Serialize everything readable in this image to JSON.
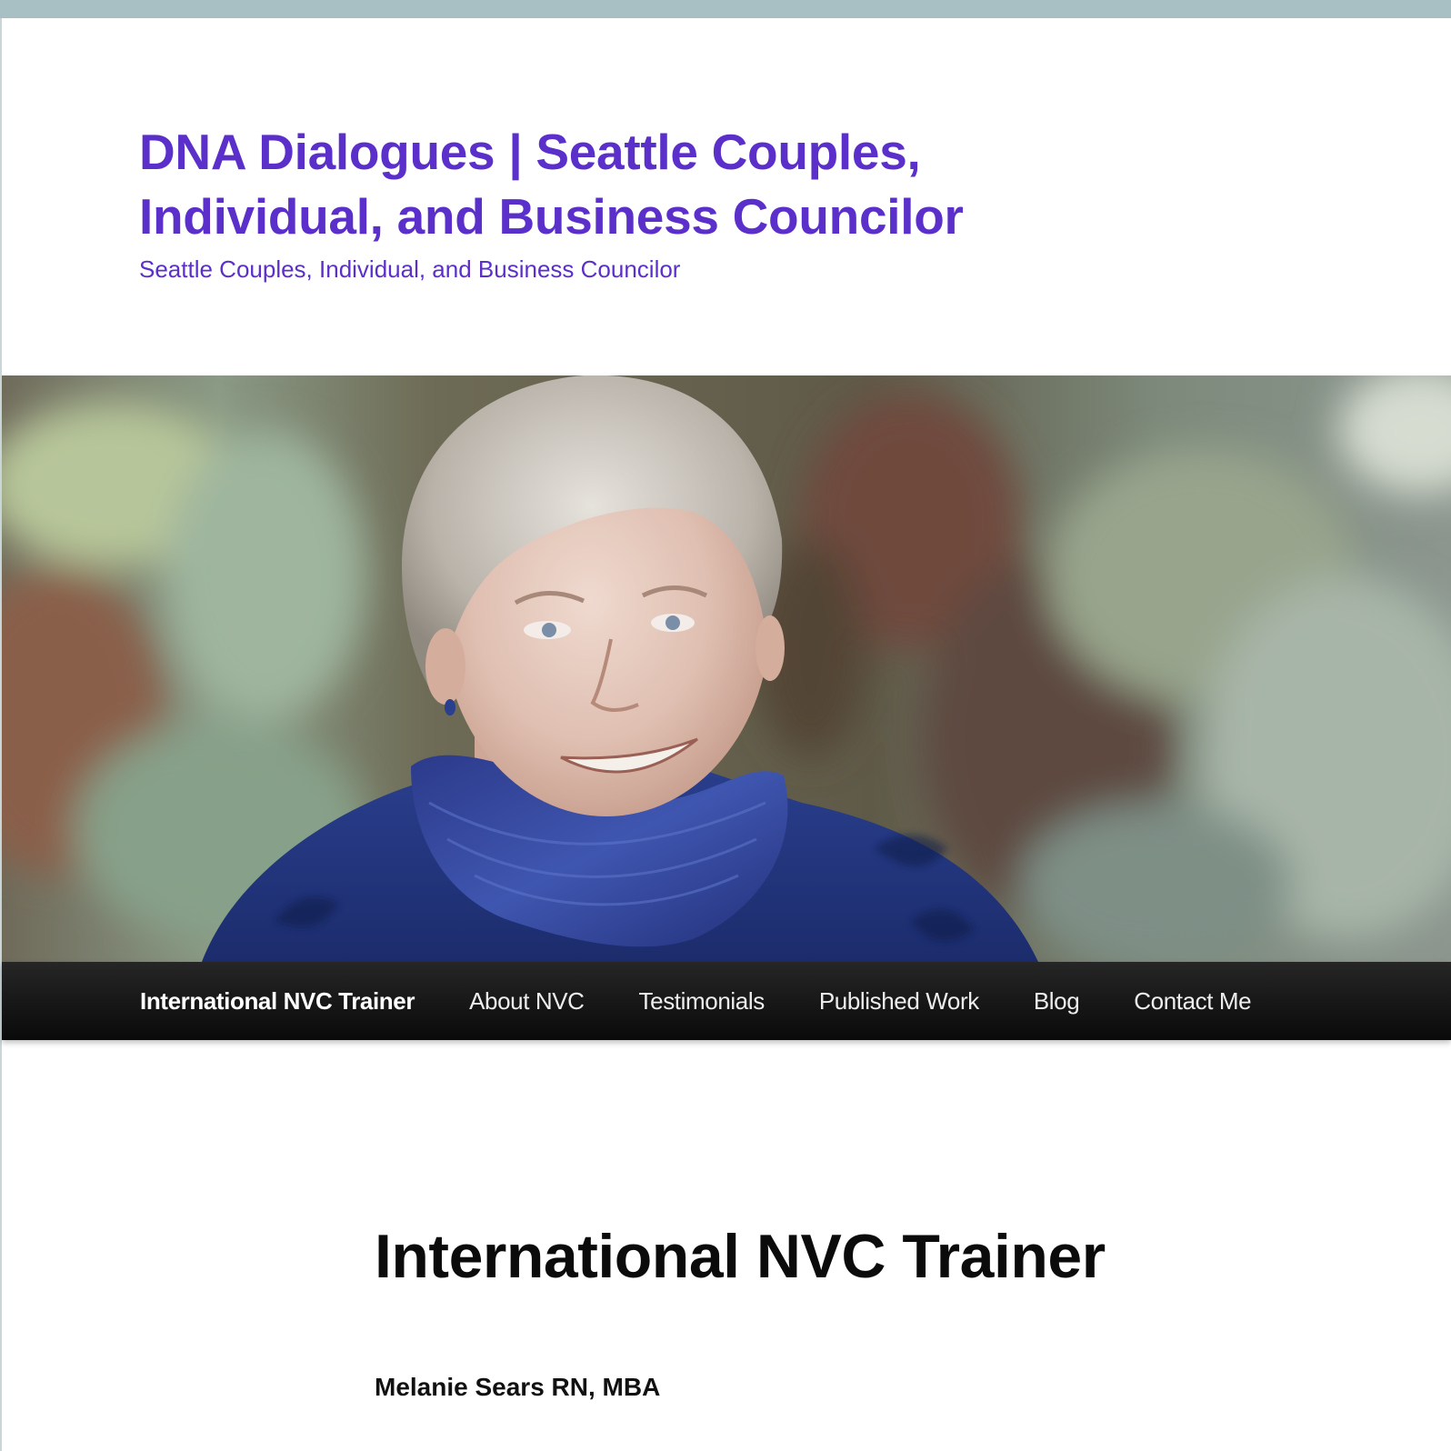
{
  "site": {
    "title": "DNA Dialogues | Seattle Couples, Individual, and Business Councilor",
    "description": "Seattle Couples, Individual, and Business Councilor",
    "title_color": "#5b2fc9"
  },
  "hero": {
    "alt": "Portrait of smiling woman with short gray hair wearing blue scarf"
  },
  "nav": {
    "items": [
      {
        "label": "International NVC Trainer",
        "current": true
      },
      {
        "label": "About NVC"
      },
      {
        "label": "Testimonials"
      },
      {
        "label": "Published Work"
      },
      {
        "label": "Blog"
      },
      {
        "label": "Contact Me"
      }
    ]
  },
  "content": {
    "title": "International NVC Trainer",
    "author": "Melanie Sears RN, MBA"
  }
}
